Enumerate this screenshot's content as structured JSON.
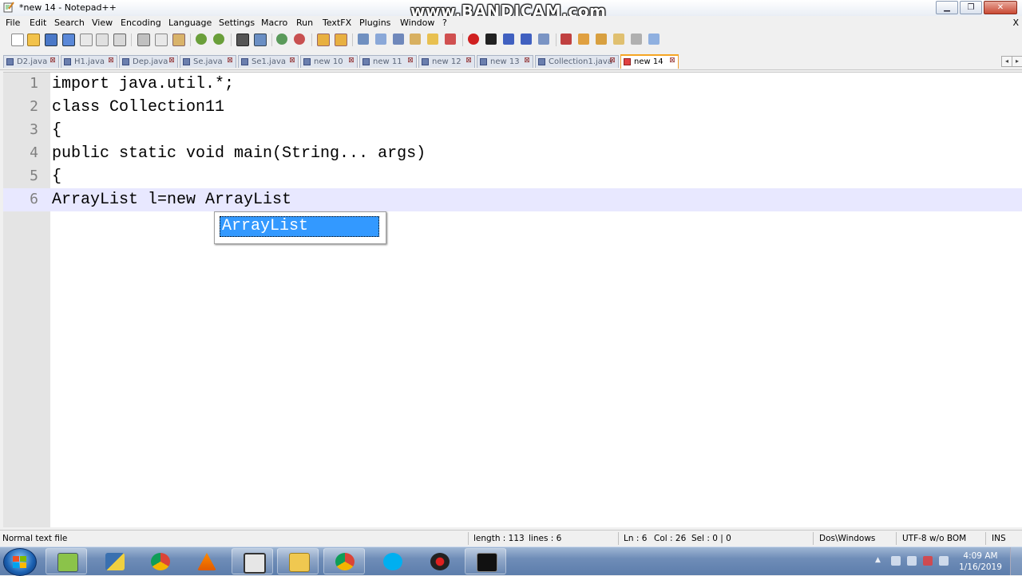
{
  "window": {
    "title": "*new 14 - Notepad++",
    "watermark": "www.BANDICAM.com",
    "close_x": "X"
  },
  "menu": [
    "File",
    "Edit",
    "Search",
    "View",
    "Encoding",
    "Language",
    "Settings",
    "Macro",
    "Run",
    "TextFX",
    "Plugins",
    "Window",
    "?"
  ],
  "tabs": [
    {
      "label": "D2.java",
      "active": false
    },
    {
      "label": "H1.java",
      "active": false
    },
    {
      "label": "Dep.java",
      "active": false
    },
    {
      "label": "Se.java",
      "active": false
    },
    {
      "label": "Se1.java",
      "active": false
    },
    {
      "label": "new 10",
      "active": false
    },
    {
      "label": "new 11",
      "active": false
    },
    {
      "label": "new 12",
      "active": false
    },
    {
      "label": "new 13",
      "active": false
    },
    {
      "label": "Collection1.java",
      "active": false
    },
    {
      "label": "new 14",
      "active": true
    }
  ],
  "editor": {
    "lines": [
      {
        "num": "1",
        "code": "import java.util.*;"
      },
      {
        "num": "2",
        "code": "class Collection11"
      },
      {
        "num": "3",
        "code": "{"
      },
      {
        "num": "4",
        "code": "public static void main(String... args)"
      },
      {
        "num": "5",
        "code": "{"
      },
      {
        "num": "6",
        "code": "ArrayList l=new ArrayList"
      }
    ],
    "current_line": 6,
    "autocomplete": {
      "selected": "ArrayList"
    }
  },
  "status": {
    "file_type": "Normal text file",
    "length": "length : 113",
    "lines": "lines : 6",
    "ln": "Ln : 6",
    "col": "Col : 26",
    "sel": "Sel : 0 | 0",
    "eol": "Dos\\Windows",
    "encoding": "UTF-8 w/o BOM",
    "mode": "INS"
  },
  "taskbar": {
    "apps": [
      "notepad-plus-plus",
      "python",
      "chrome",
      "vlc",
      "virtualbox",
      "file-explorer",
      "chrome",
      "skype",
      "bandicam",
      "command-prompt"
    ],
    "clock_time": "4:09 AM",
    "clock_date": "1/16/2019"
  }
}
